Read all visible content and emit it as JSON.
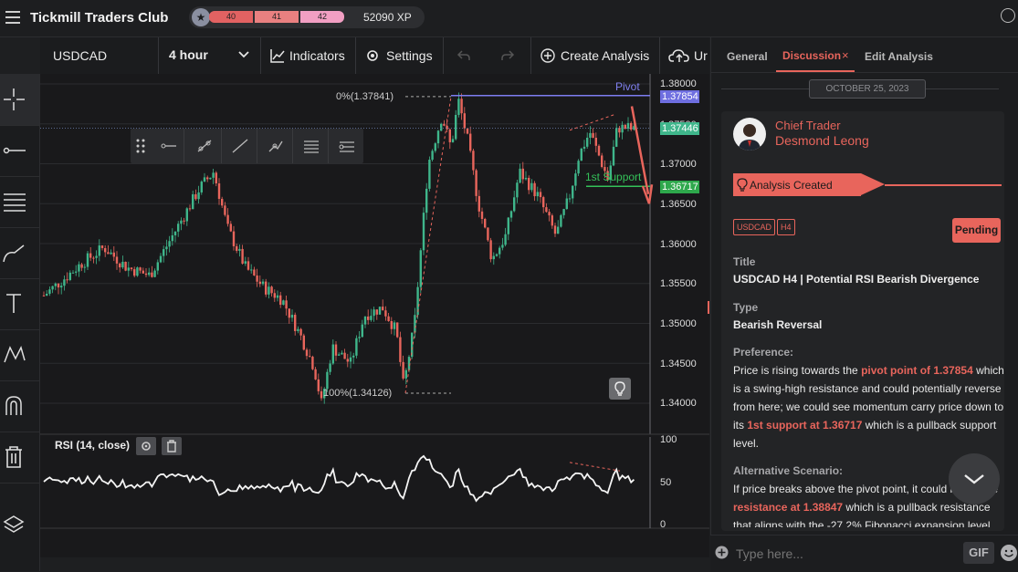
{
  "app": {
    "title": "Tickmill Traders Club",
    "levels": [
      "40",
      "41",
      "42"
    ],
    "xp": "52090 XP"
  },
  "toolbar": {
    "symbol": "USDCAD",
    "timeframe": "4 hour",
    "indicators": "Indicators",
    "settings": "Settings",
    "create_analysis": "Create Analysis",
    "upload_truncated": "Ur"
  },
  "chart": {
    "price_ticks": [
      "1.38000",
      "1.37500",
      "1.37000",
      "1.36500",
      "1.36000",
      "1.35500",
      "1.35000",
      "1.34500",
      "1.34000"
    ],
    "pivot_label": "Pivot",
    "pivot_price": "1.37854",
    "current_price": "1.37446",
    "support_label": "1st Support",
    "support_price": "1.36717",
    "fib_top": "0%(1.37841)",
    "fib_bottom": "100%(1.34126)",
    "rsi_label": "RSI (14, close)",
    "rsi_ticks": [
      "100",
      "50",
      "0"
    ],
    "colors": {
      "up": "#3fb68b",
      "down": "#e8655c",
      "pivot": "#7d7df0",
      "support": "#34c159",
      "accent": "#e8655c"
    }
  },
  "panel": {
    "tabs": [
      "General",
      "Discussion",
      "Edit Analysis"
    ],
    "date": "OCTOBER 25, 2023",
    "author_role": "Chief Trader",
    "author_name": "Desmond Leong",
    "event": "Analysis Created",
    "tags": [
      "USDCAD",
      "H4"
    ],
    "status": "Pending",
    "title_h": "Title",
    "title_v": "USDCAD H4 | Potential RSI Bearish Divergence",
    "type_h": "Type",
    "type_v": "Bearish Reversal",
    "pref_h": "Preference:",
    "pref_1": "Price is rising towards the ",
    "pref_hl1": "pivot point of 1.37854",
    "pref_2": " which is a swing-high resistance and could potentially reverse from here; we could see momentum carry price down to its ",
    "pref_hl2": "1st support at 1.36717",
    "pref_3": " which is a pullback support level.",
    "alt_h": "Alternative Scenario:",
    "alt_1": "If price breaks above the pivot point, it could rise to the ",
    "alt_hl": "resistance at 1.38847",
    "alt_2": " which is a pullback resistance that aligns with the -27.2% Fibonacci expansion level.",
    "chat_placeholder": "Type here...",
    "gif": "GIF"
  }
}
